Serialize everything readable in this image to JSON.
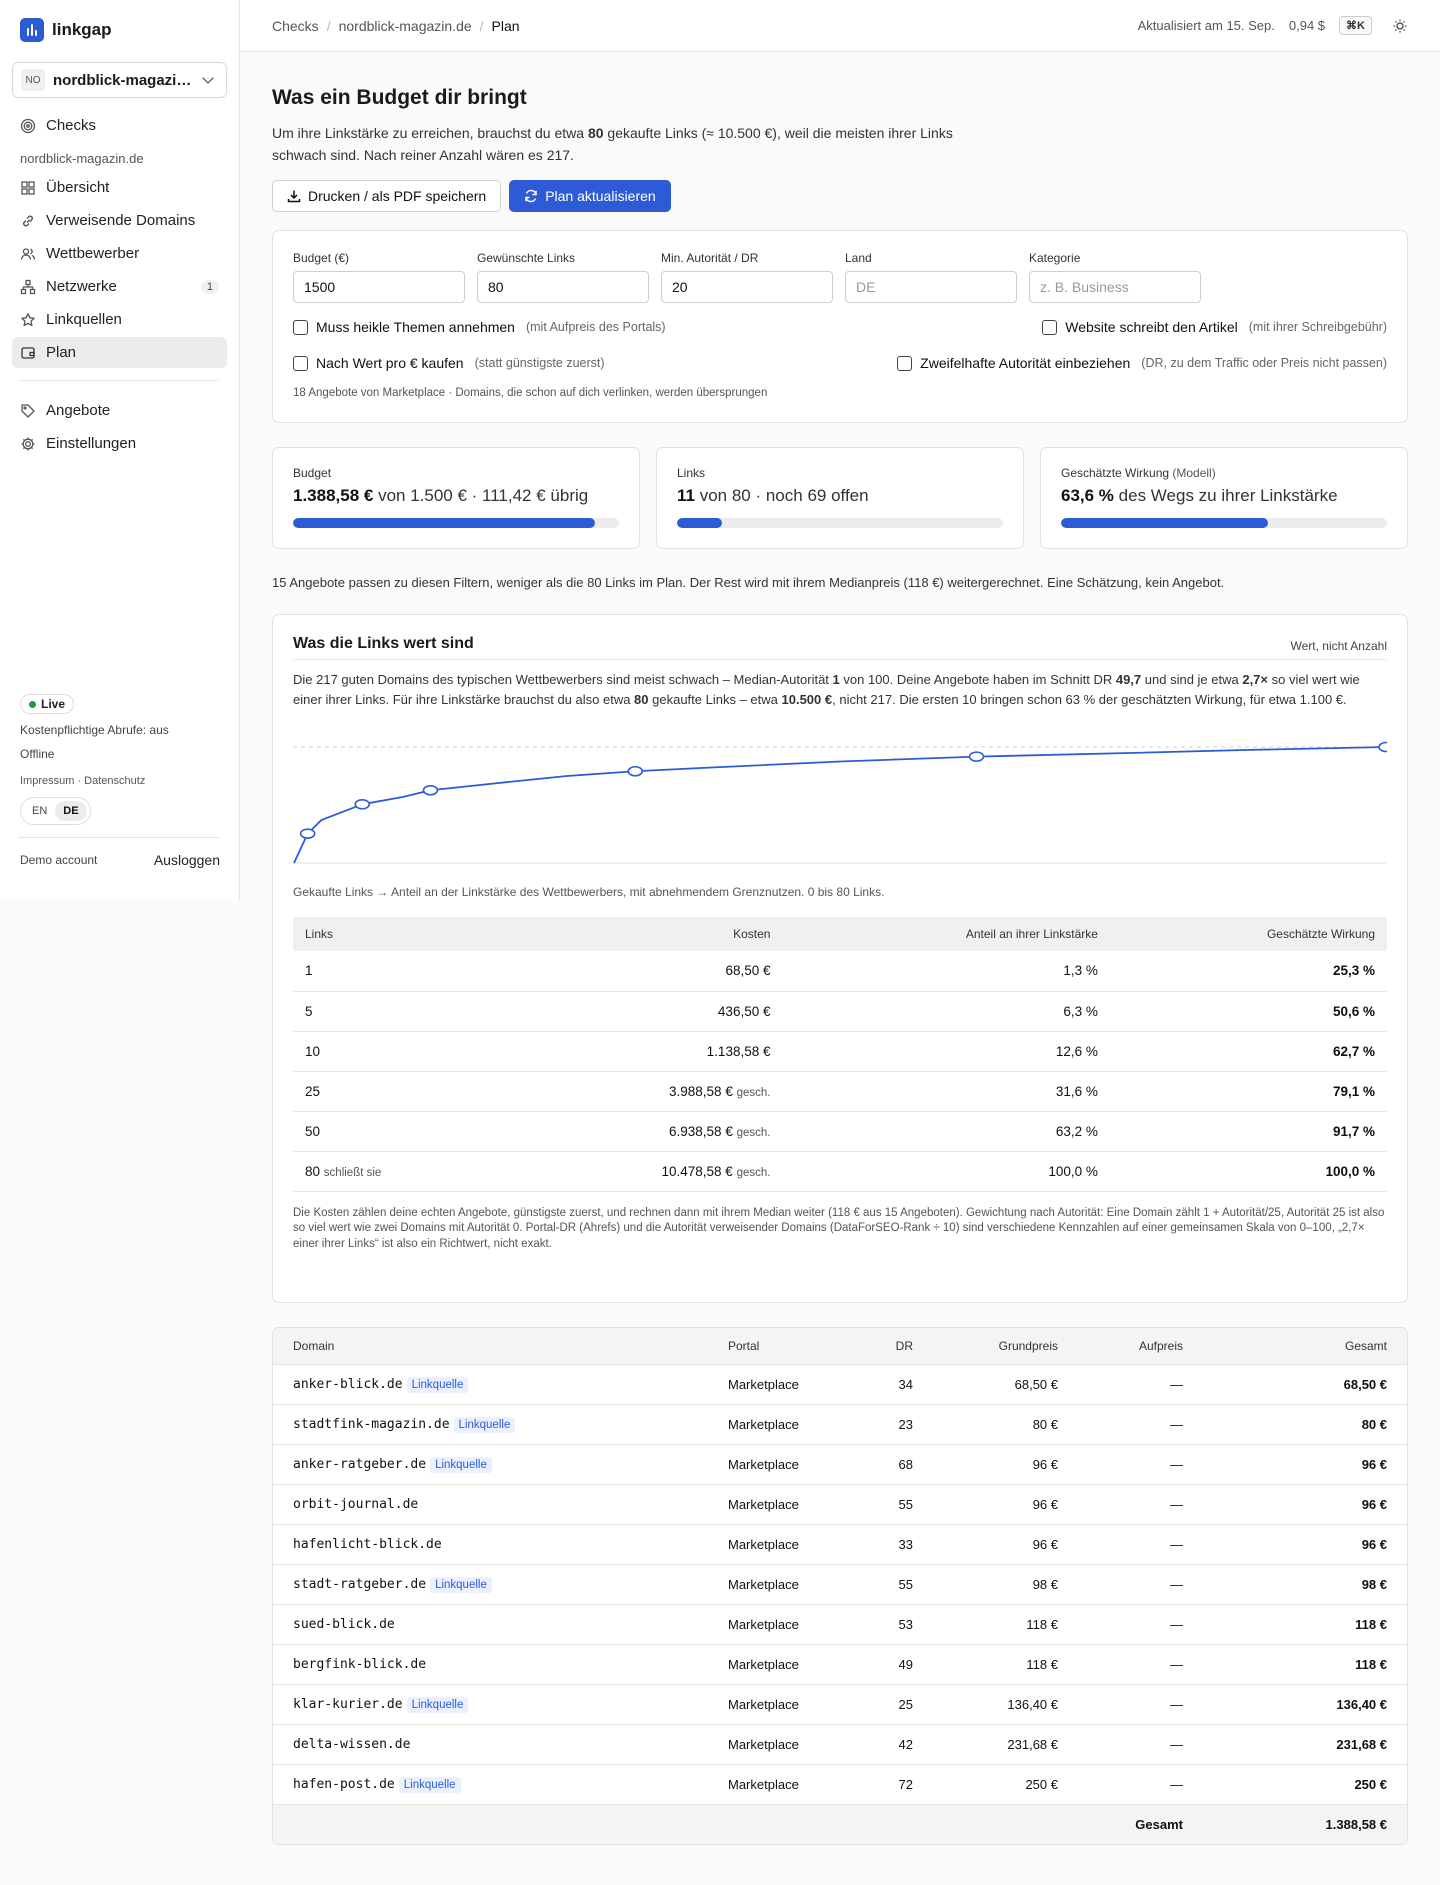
{
  "app": {
    "name": "linkgap"
  },
  "sidebar": {
    "site_badge": "NO",
    "site_name": "nordblick-magazin.de",
    "top_item": "Checks",
    "section": "nordblick-magazin.de",
    "items": [
      {
        "label": "Übersicht",
        "icon": "grid-icon"
      },
      {
        "label": "Verweisende Domains",
        "icon": "link-icon"
      },
      {
        "label": "Wettbewerber",
        "icon": "users-icon"
      },
      {
        "label": "Netzwerke",
        "icon": "network-icon",
        "count": "1"
      },
      {
        "label": "Linkquellen",
        "icon": "star-icon"
      },
      {
        "label": "Plan",
        "icon": "wallet-icon",
        "active": true
      }
    ],
    "items2": [
      {
        "label": "Angebote",
        "icon": "tag-icon"
      },
      {
        "label": "Einstellungen",
        "icon": "gear-icon"
      }
    ],
    "status": "Live",
    "paid_calls": "Kostenpflichtige Abrufe: aus",
    "offline": "Offline",
    "legal": "Impressum · Datenschutz",
    "lang_en": "EN",
    "lang_de": "DE",
    "account": "Demo account",
    "logout": "Ausloggen"
  },
  "topbar": {
    "crumbs": [
      "Checks",
      "nordblick-magazin.de",
      "Plan"
    ],
    "updated": "Aktualisiert am 15. Sep.",
    "cost": "0,94 $",
    "shortcut": "⌘K"
  },
  "header": {
    "title": "Was ein Budget dir bringt",
    "intro_1": "Um ihre Linkstärke zu erreichen, brauchst du etwa ",
    "intro_num": "80",
    "intro_2": " gekaufte Links (≈ 10.500 €), weil die meisten ihrer Links schwach sind. Nach reiner Anzahl wären es 217.",
    "print_label": "Drucken / als PDF speichern",
    "refresh_label": "Plan aktualisieren"
  },
  "filters": {
    "budget": {
      "label": "Budget (€)",
      "value": "1500"
    },
    "links": {
      "label": "Gewünschte Links",
      "value": "80"
    },
    "min_dr": {
      "label": "Min. Autorität / DR",
      "value": "20"
    },
    "country": {
      "label": "Land",
      "placeholder": "DE"
    },
    "category": {
      "label": "Kategorie",
      "placeholder": "z. B. Business"
    },
    "chk_sensitive": {
      "label": "Muss heikle Themen annehmen",
      "hint": "(mit Aufpreis des Portals)"
    },
    "chk_writes": {
      "label": "Website schreibt den Artikel",
      "hint": "(mit ihrer Schreibgebühr)"
    },
    "chk_value": {
      "label": "Nach Wert pro € kaufen",
      "hint": "(statt günstigste zuerst)"
    },
    "chk_dubious": {
      "label": "Zweifelhafte Autorität einbeziehen",
      "hint": "(DR, zu dem Traffic oder Preis nicht passen)"
    },
    "note": "18 Angebote von Marketplace · Domains, die schon auf dich verlinken, werden übersprungen"
  },
  "stats": {
    "budget": {
      "title": "Budget",
      "bold": "1.388,58 €",
      "rest": " von 1.500 € · 111,42 € übrig",
      "fraction": 0.926
    },
    "links": {
      "title": "Links",
      "bold": "11",
      "rest": " von 80 · noch 69 offen",
      "fraction": 0.1375
    },
    "effect": {
      "title": "Geschätzte Wirkung",
      "title_extra": " (Modell)",
      "bold": "63,6 %",
      "rest": " des Wegs zu ihrer Linkstärke",
      "fraction": 0.636
    }
  },
  "filter_note": "15 Angebote passen zu diesen Filtern, weniger als die 80 Links im Plan. Der Rest wird mit ihrem Medianpreis (118 €) weitergerechnet. Eine Schätzung, kein Angebot.",
  "value_card": {
    "title": "Was die Links wert sind",
    "badge": "Wert, nicht Anzahl",
    "desc_1": "Die 217 guten Domains des typischen Wettbewerbers sind meist schwach – Median-Autorität ",
    "desc_b1": "1",
    "desc_2": " von 100. Deine Angebote haben im Schnitt DR ",
    "desc_b2": "49,7",
    "desc_3": " und sind je etwa ",
    "desc_b3": "2,7×",
    "desc_4": " so viel wert wie einer ihrer Links. Für ihre Linkstärke brauchst du also etwa ",
    "desc_b4": "80",
    "desc_5": " gekaufte Links – etwa ",
    "desc_b5": "10.500 €",
    "desc_6": ", nicht 217. Die ersten 10 bringen schon 63 % der geschätzten Wirkung, für etwa 1.100 €.",
    "caption": "Gekaufte Links → Anteil an der Linkstärke des Wettbewerbers, mit abnehmendem Grenznutzen. 0 bis 80 Links.",
    "headers": [
      "Links",
      "Kosten",
      "Anteil an ihrer Linkstärke",
      "Geschätzte Wirkung"
    ],
    "rows": [
      {
        "links": "1",
        "links_note": "",
        "cost": "68,50 €",
        "cost_note": "",
        "share": "1,3 %",
        "effect": "25,3 %"
      },
      {
        "links": "5",
        "links_note": "",
        "cost": "436,50 €",
        "cost_note": "",
        "share": "6,3 %",
        "effect": "50,6 %"
      },
      {
        "links": "10",
        "links_note": "",
        "cost": "1.138,58 €",
        "cost_note": "",
        "share": "12,6 %",
        "effect": "62,7 %"
      },
      {
        "links": "25",
        "links_note": "",
        "cost": "3.988,58 €",
        "cost_note": "gesch.",
        "share": "31,6 %",
        "effect": "79,1 %"
      },
      {
        "links": "50",
        "links_note": "",
        "cost": "6.938,58 €",
        "cost_note": "gesch.",
        "share": "63,2 %",
        "effect": "91,7 %"
      },
      {
        "links": "80",
        "links_note": "schließt sie",
        "cost": "10.478,58 €",
        "cost_note": "gesch.",
        "share": "100,0 %",
        "effect": "100,0 %"
      }
    ],
    "footnote": "Die Kosten zählen deine echten Angebote, günstigste zuerst, und rechnen dann mit ihrem Median weiter (118 € aus 15 Angeboten). Gewichtung nach Autorität: Eine Domain zählt 1 + Autorität/25, Autorität 25 ist also so viel wert wie zwei Domains mit Autorität 0. Portal-DR (Ahrefs) und die Autorität verweisender Domains (DataForSEO-Rank ÷ 10) sind verschiedene Kennzahlen auf einer gemeinsamen Skala von 0–100, „2,7× einer ihrer Links“ ist also ein Richtwert, nicht exakt."
  },
  "chart_data": {
    "type": "line",
    "x": [
      0,
      1,
      2,
      5,
      8,
      10,
      15,
      20,
      25,
      30,
      40,
      50,
      60,
      70,
      80
    ],
    "y": [
      0,
      25.3,
      37,
      50.6,
      57,
      62.7,
      69,
      75,
      79.1,
      82,
      87.5,
      91.7,
      94.5,
      97.5,
      100
    ],
    "markers": [
      1,
      5,
      10,
      25,
      50,
      80
    ],
    "xlim": [
      0,
      80
    ],
    "ylim": [
      0,
      100
    ],
    "reference_line": 100,
    "color": "#2d5bd6"
  },
  "domains": {
    "headers": [
      "Domain",
      "Portal",
      "DR",
      "Grundpreis",
      "Aufpreis",
      "Gesamt"
    ],
    "tag_label": "Linkquelle",
    "rows": [
      {
        "domain": "anker-blick.de",
        "tag": true,
        "portal": "Marketplace",
        "dr": "34",
        "base": "68,50 €",
        "extra": "—",
        "total": "68,50 €"
      },
      {
        "domain": "stadtfink-magazin.de",
        "tag": true,
        "portal": "Marketplace",
        "dr": "23",
        "base": "80 €",
        "extra": "—",
        "total": "80 €"
      },
      {
        "domain": "anker-ratgeber.de",
        "tag": true,
        "portal": "Marketplace",
        "dr": "68",
        "base": "96 €",
        "extra": "—",
        "total": "96 €"
      },
      {
        "domain": "orbit-journal.de",
        "tag": false,
        "portal": "Marketplace",
        "dr": "55",
        "base": "96 €",
        "extra": "—",
        "total": "96 €"
      },
      {
        "domain": "hafenlicht-blick.de",
        "tag": false,
        "portal": "Marketplace",
        "dr": "33",
        "base": "96 €",
        "extra": "—",
        "total": "96 €"
      },
      {
        "domain": "stadt-ratgeber.de",
        "tag": true,
        "portal": "Marketplace",
        "dr": "55",
        "base": "98 €",
        "extra": "—",
        "total": "98 €"
      },
      {
        "domain": "sued-blick.de",
        "tag": false,
        "portal": "Marketplace",
        "dr": "53",
        "base": "118 €",
        "extra": "—",
        "total": "118 €"
      },
      {
        "domain": "bergfink-blick.de",
        "tag": false,
        "portal": "Marketplace",
        "dr": "49",
        "base": "118 €",
        "extra": "—",
        "total": "118 €"
      },
      {
        "domain": "klar-kurier.de",
        "tag": true,
        "portal": "Marketplace",
        "dr": "25",
        "base": "136,40 €",
        "extra": "—",
        "total": "136,40 €"
      },
      {
        "domain": "delta-wissen.de",
        "tag": false,
        "portal": "Marketplace",
        "dr": "42",
        "base": "231,68 €",
        "extra": "—",
        "total": "231,68 €"
      },
      {
        "domain": "hafen-post.de",
        "tag": true,
        "portal": "Marketplace",
        "dr": "72",
        "base": "250 €",
        "extra": "—",
        "total": "250 €"
      }
    ],
    "total_label": "Gesamt",
    "total_value": "1.388,58 €"
  }
}
